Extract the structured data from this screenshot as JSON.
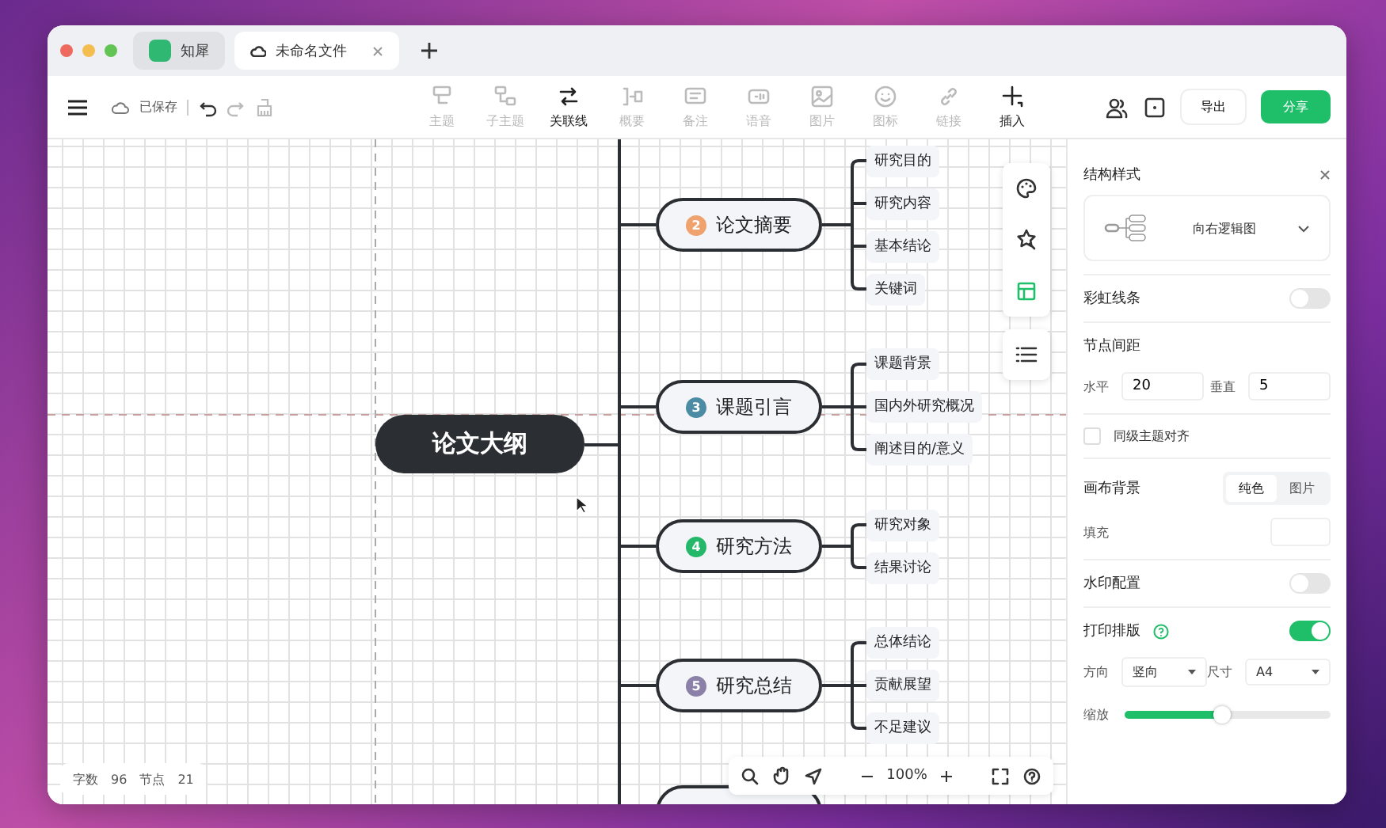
{
  "tabs": [
    {
      "kind": "app",
      "label": "知犀",
      "selected": false
    },
    {
      "kind": "file",
      "label": "未命名文件",
      "selected": true
    }
  ],
  "toolbar": {
    "save_status": "已保存",
    "tools": [
      {
        "label": "主题",
        "disabled": true
      },
      {
        "label": "子主题",
        "disabled": true
      },
      {
        "label": "关联线",
        "disabled": false
      },
      {
        "label": "概要",
        "disabled": true
      },
      {
        "label": "备注",
        "disabled": true
      },
      {
        "label": "语音",
        "disabled": true
      },
      {
        "label": "图片",
        "disabled": true
      },
      {
        "label": "图标",
        "disabled": true
      },
      {
        "label": "链接",
        "disabled": true
      },
      {
        "label": "插入",
        "disabled": false
      }
    ],
    "export": "导出",
    "share": "分享"
  },
  "mindmap": {
    "root": "论文大纲",
    "topics": [
      {
        "number": "2",
        "label": "论文摘要",
        "color": "#f0a26e",
        "children": [
          "研究目的",
          "研究内容",
          "基本结论",
          "关键词"
        ]
      },
      {
        "number": "3",
        "label": "课题引言",
        "color": "#4b8ba3",
        "children": [
          "课题背景",
          "国内外研究概况",
          "阐述目的/意义"
        ]
      },
      {
        "number": "4",
        "label": "研究方法",
        "color": "#25b86b",
        "children": [
          "研究对象",
          "结果讨论"
        ]
      },
      {
        "number": "5",
        "label": "研究总结",
        "color": "#8b80a8",
        "children": [
          "总体结论",
          "贡献展望",
          "不足建议"
        ]
      }
    ]
  },
  "status": {
    "words_label": "字数",
    "words": "96",
    "nodes_label": "节点",
    "nodes": "21"
  },
  "zoom": "100%",
  "panel": {
    "title": "结构样式",
    "structure": "向右逻辑图",
    "rainbow": {
      "label": "彩虹线条",
      "on": false
    },
    "spacing": {
      "label": "节点间距",
      "h_label": "水平",
      "h": "20",
      "v_label": "垂直",
      "v": "5"
    },
    "align": {
      "label": "同级主题对齐",
      "checked": false
    },
    "background": {
      "label": "画布背景",
      "options": [
        {
          "label": "纯色",
          "selected": true
        },
        {
          "label": "图片",
          "selected": false
        }
      ],
      "fill_label": "填充"
    },
    "watermark": {
      "label": "水印配置",
      "on": false
    },
    "print": {
      "label": "打印排版",
      "on": true,
      "dir_label": "方向",
      "dir": "竖向",
      "size_label": "尺寸",
      "size": "A4",
      "scale_label": "缩放",
      "level": 0.47
    }
  }
}
